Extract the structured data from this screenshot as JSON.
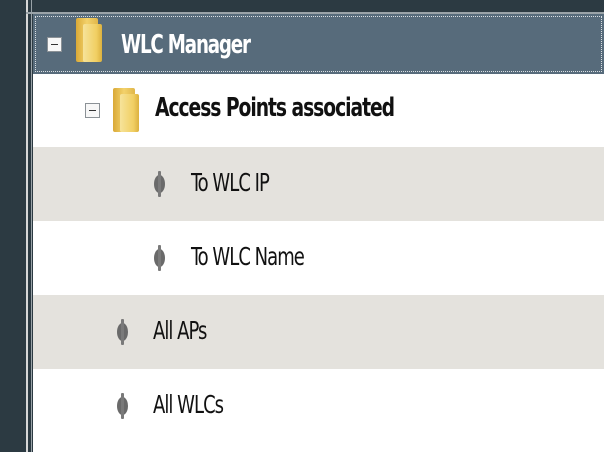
{
  "tree": {
    "root": {
      "label": "WLC Manager",
      "expanded": true,
      "icon": "folder-icon"
    },
    "group": {
      "label": "Access Points associated",
      "expanded": true,
      "icon": "folder-icon"
    },
    "items": [
      {
        "label": "To WLC IP",
        "icon": "bullet-icon"
      },
      {
        "label": "To WLC Name",
        "icon": "bullet-icon"
      },
      {
        "label": "All APs",
        "icon": "bullet-icon"
      },
      {
        "label": "All WLCs",
        "icon": "bullet-icon"
      }
    ]
  },
  "colors": {
    "background": "#2c3a42",
    "selected_row": "#576b7b",
    "shaded_row": "#e4e2dd",
    "folder": "#f1cf63"
  }
}
